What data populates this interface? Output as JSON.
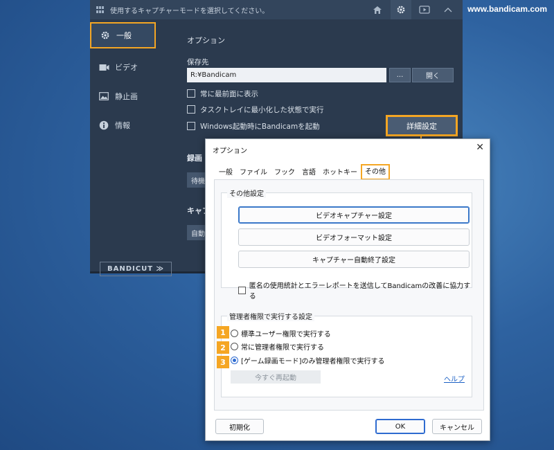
{
  "watermark": "www.bandicam.com",
  "colors": {
    "accent_highlight": "#f5a623",
    "window_bg": "#2b3a4e",
    "link": "#1a5fc4"
  },
  "main_window": {
    "title": "使用するキャプチャーモードを選択してください。",
    "title_icons": [
      "home-icon",
      "gear-icon",
      "video-icon",
      "chevron-up-icon"
    ],
    "sidebar": {
      "items": [
        {
          "label": "一般",
          "icon": "gear-icon",
          "selected": true
        },
        {
          "label": "ビデオ",
          "icon": "video-camera-icon",
          "selected": false
        },
        {
          "label": "静止画",
          "icon": "image-icon",
          "selected": false
        },
        {
          "label": "情報",
          "icon": "info-icon",
          "selected": false
        }
      ],
      "bandicut_label": "BANDICUT ≫"
    },
    "options": {
      "heading": "オプション",
      "save_to_label": "保存先",
      "save_path": "R:¥Bandicam",
      "browse_label": "...",
      "open_label": "開く",
      "checkboxes": [
        {
          "label": "常に最前面に表示",
          "checked": false
        },
        {
          "label": "タスクトレイに最小化した状態で実行",
          "checked": false
        },
        {
          "label": "Windows起動時にBandicamを起動",
          "checked": false
        }
      ],
      "advanced_button": "詳細設定"
    },
    "partial": {
      "record_heading": "録画",
      "record_field": "待機",
      "capture_heading": "キャプ",
      "capture_field": "自動"
    }
  },
  "dialog": {
    "title": "オプション",
    "close": "✕",
    "tabs": [
      {
        "label": "一般",
        "selected": false
      },
      {
        "label": "ファイル",
        "selected": false
      },
      {
        "label": "フック",
        "selected": false
      },
      {
        "label": "言語",
        "selected": false
      },
      {
        "label": "ホットキー",
        "selected": false
      },
      {
        "label": "その他",
        "selected": true
      }
    ],
    "other_settings": {
      "label": "その他設定",
      "buttons": [
        "ビデオキャプチャー設定",
        "ビデオフォーマット設定",
        "キャプチャー自動終了設定"
      ],
      "anonymous_checkbox": {
        "label": "匿名の使用統計とエラーレポートを送信してBandicamの改善に協力する",
        "checked": false
      }
    },
    "admin_settings": {
      "label": "管理者権限で実行する設定",
      "radios": [
        {
          "badge": "1",
          "label": "標準ユーザー権限で実行する",
          "selected": false
        },
        {
          "badge": "2",
          "label": "常に管理者権限で実行する",
          "selected": false
        },
        {
          "badge": "3",
          "label": "[ゲーム録画モード]のみ管理者権限で実行する",
          "selected": true
        }
      ],
      "restart_button": "今すぐ再起動",
      "help_link": "ヘルプ"
    },
    "footer": {
      "reset": "初期化",
      "ok": "OK",
      "cancel": "キャンセル"
    }
  }
}
